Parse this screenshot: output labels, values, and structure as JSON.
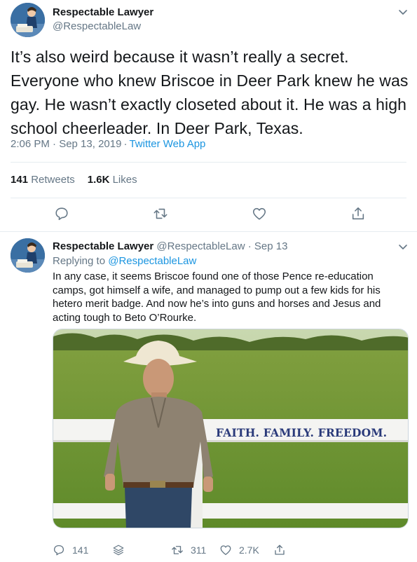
{
  "tweet": {
    "display_name": "Respectable Lawyer",
    "handle": "@RespectableLaw",
    "text": "It’s also weird because it wasn’t really a secret. Everyone who knew Briscoe in Deer Park knew he was gay. He wasn’t exactly closeted about it. He was a high school cheerleader. In Deer Park, Texas.",
    "timestamp": "2:06 PM · Sep 13, 2019",
    "separator": "·",
    "source": "Twitter Web App",
    "retweet_count": "141",
    "retweet_label": "Retweets",
    "like_count": "1.6K",
    "like_label": "Likes"
  },
  "reply": {
    "display_name": "Respectable Lawyer",
    "handle_date": "@RespectableLaw · Sep 13",
    "replying_prefix": "Replying to",
    "replying_to": "@RespectableLaw",
    "text": "In any case, it seems Briscoe found one of those Pence re-education camps, got himself a wife, and managed to pump out a few kids for his hetero merit badge. And now he’s into guns and horses and Jesus and acting tough to Beto O’Rourke.",
    "image_sign_text": "FAITH. FAMILY. FREEDOM.",
    "reply_count": "141",
    "retweet_count": "311",
    "like_count": "2.7K"
  },
  "icons": {
    "caret": "chevron-down-icon",
    "reply": "comment-bubble-icon",
    "retweet": "retweet-arrows-icon",
    "like": "heart-icon",
    "share": "share-upload-icon",
    "layers": "layers-stack-icon"
  },
  "colors": {
    "text": "#14171a",
    "secondary": "#657786",
    "link": "#1b95e0",
    "divider": "#e6ecf0"
  }
}
